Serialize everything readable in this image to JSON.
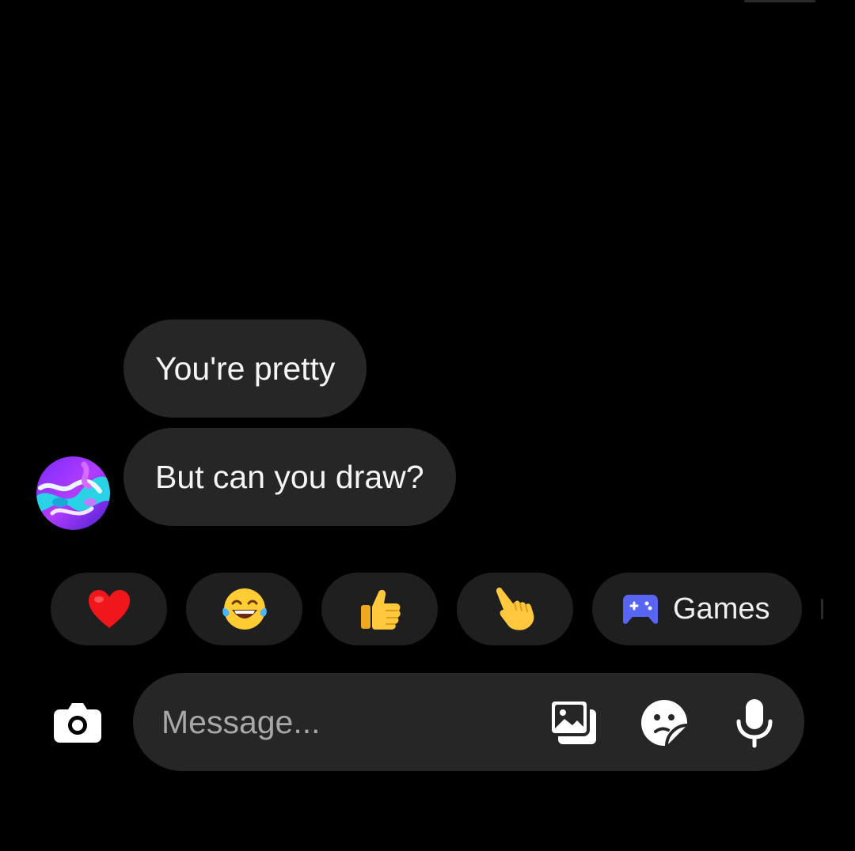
{
  "messages": [
    {
      "text": "You're pretty"
    },
    {
      "text": "But can you draw?"
    }
  ],
  "sender": {
    "avatar_icon": "marbled-gradient-avatar"
  },
  "quick_replies": {
    "emojis": [
      {
        "icon": "red-heart-emoji"
      },
      {
        "icon": "tears-of-joy-emoji"
      },
      {
        "icon": "thumbs-up-emoji"
      },
      {
        "icon": "pointing-hand-emoji"
      }
    ],
    "games_label": "Games",
    "games_icon": "gamepad-icon"
  },
  "composer": {
    "placeholder": "Message...",
    "camera_icon": "camera-icon",
    "gallery_icon": "gallery-icon",
    "sticker_icon": "sticker-icon",
    "mic_icon": "microphone-icon"
  },
  "colors": {
    "background": "#000000",
    "bubble": "#262626",
    "chip": "#1f1f1f",
    "games_icon": "#5865f2",
    "placeholder": "#a8a8a8"
  }
}
